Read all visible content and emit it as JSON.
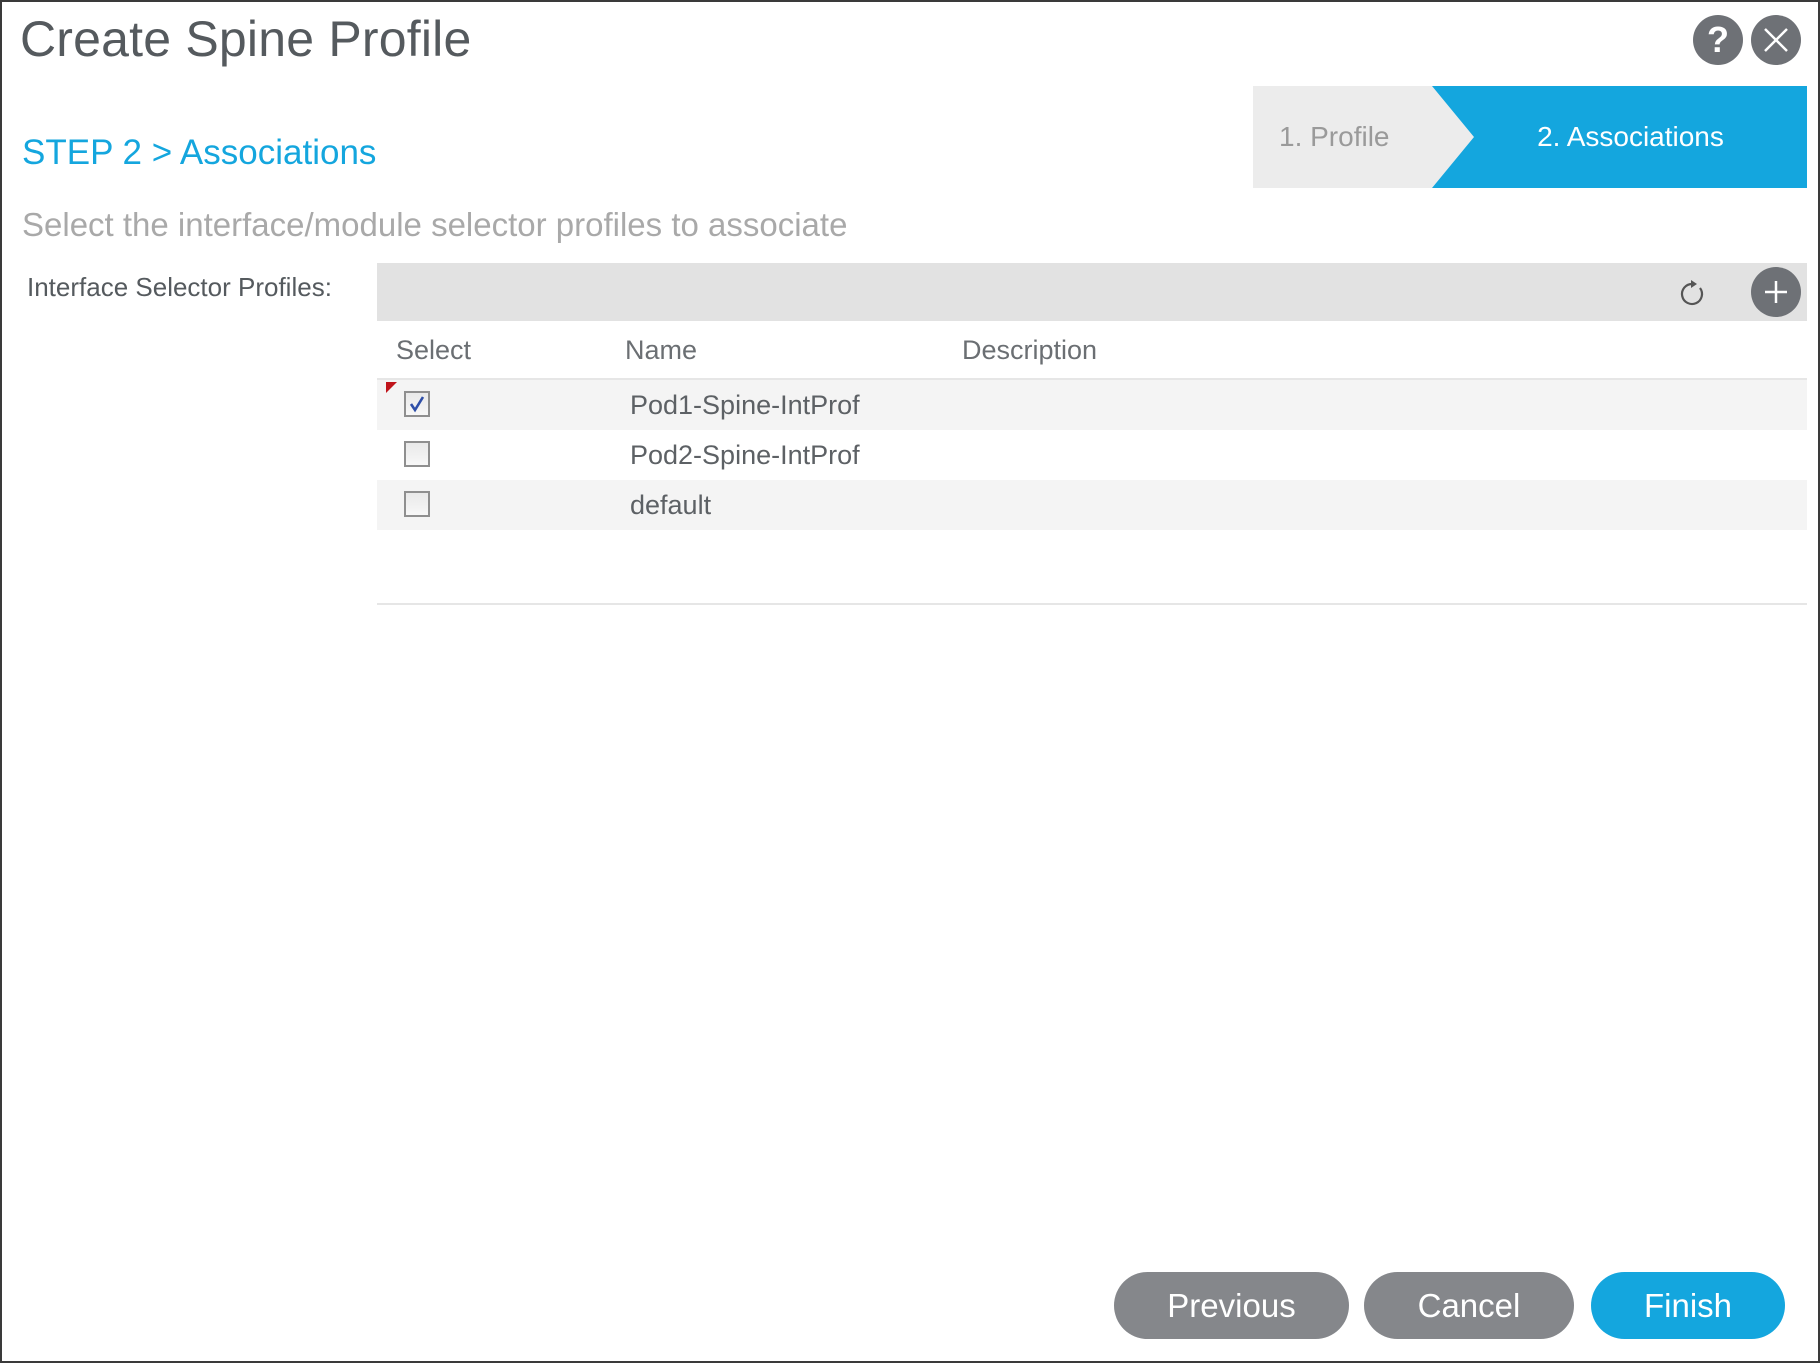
{
  "dialog": {
    "title": "Create Spine Profile",
    "help_icon": "help-icon",
    "close_icon": "close-icon"
  },
  "wizard": {
    "steps": [
      {
        "label": "1. Profile",
        "active": false
      },
      {
        "label": "2. Associations",
        "active": true
      }
    ]
  },
  "step_heading": "STEP 2 > Associations",
  "subtitle": "Select the interface/module selector profiles to associate",
  "interface_selector_profiles": {
    "label": "Interface Selector Profiles:",
    "toolbar_icons": [
      "refresh-icon",
      "add-icon"
    ],
    "columns": [
      "Select",
      "Name",
      "Description"
    ],
    "rows": [
      {
        "selected": true,
        "name": "Pod1-Spine-IntProf",
        "description": ""
      },
      {
        "selected": false,
        "name": "Pod2-Spine-IntProf",
        "description": ""
      },
      {
        "selected": false,
        "name": "default",
        "description": ""
      }
    ]
  },
  "footer": {
    "previous_label": "Previous",
    "cancel_label": "Cancel",
    "finish_label": "Finish"
  },
  "colors": {
    "accent": "#14a6de",
    "button_gray": "#85878b",
    "icon_gray": "#6e7176",
    "dirty_marker": "#c0141b"
  }
}
